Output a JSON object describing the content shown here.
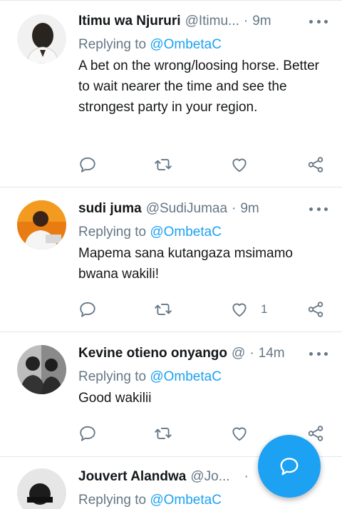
{
  "tweets": [
    {
      "name": "Itimu wa Njururi",
      "handle": "@Itimu...",
      "dot": "·",
      "time": "9m",
      "replying_prefix": "Replying to",
      "replying_to": "@OmbetaC",
      "text": "A bet on the wrong/loosing horse. Better to wait nearer the time and see the strongest party in your region.",
      "like_count": ""
    },
    {
      "name": "sudi juma",
      "handle": "@SudiJumaa",
      "dot": "·",
      "time": "9m",
      "replying_prefix": "Replying to",
      "replying_to": "@OmbetaC",
      "text": "Mapema sana kutangaza msimamo bwana wakili!",
      "like_count": "1"
    },
    {
      "name": "Kevine otieno onyango",
      "handle": "@",
      "dot": "·",
      "time": "14m",
      "replying_prefix": "Replying to",
      "replying_to": "@OmbetaC",
      "text": "Good wakilii",
      "like_count": ""
    },
    {
      "name": "Jouvert Alandwa",
      "handle": "@Jo...",
      "dot": "·",
      "time": "",
      "replying_prefix": "Replying to",
      "replying_to": "@OmbetaC",
      "text": "",
      "like_count": ""
    }
  ],
  "colors": {
    "accent": "#1da1f2",
    "secondary_text": "#657786",
    "divider": "#e1e8ed"
  },
  "icons": {
    "reply": "reply-icon",
    "retweet": "retweet-icon",
    "like": "heart-icon",
    "share": "share-icon",
    "fab": "compose-reply-icon"
  }
}
